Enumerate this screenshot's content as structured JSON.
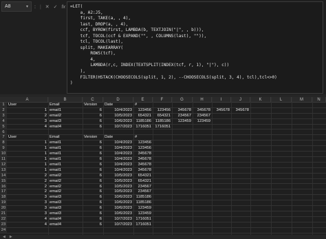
{
  "namebox": {
    "value": "A8"
  },
  "formula_bar": {
    "colon": ":",
    "cancel_icon": "x-icon",
    "enter_icon": "check-icon",
    "fx_label": "fx",
    "chevron": "⌄",
    "formula": "=LET(\n    a, A2:J5,\n    first, TAKE(a, , 4),\n    last, DROP(a, , 4),\n    ccf, BYROW(first, LAMBDA(b, TEXTJOIN(\"|\", , b))),\n    tcf, TOCOL(ccf & EXPAND(\"\", , COLUMNS(last), \"\")),\n    tcl, TOCOL(last),\n    split, MAKEARRAY(\n        ROWS(tcf),\n        4,\n        LAMBDA(r,c, INDEX(TEXTSPLIT(INDEX(tcf, r, 1), \"|\"), c))\n    ),\n    FILTER(HSTACK(CHOOSECOLS(split, 1, 2), --CHOOSECOLS(split, 3, 4), tcl),tcl<>0)\n)"
  },
  "columns": [
    "A",
    "B",
    "C",
    "D",
    "E",
    "F",
    "G",
    "H",
    "I",
    "J",
    "K",
    "L",
    "M",
    "N"
  ],
  "rows": [
    {
      "n": "1",
      "a": "User",
      "b": "Email",
      "c": "Version",
      "d": "Date",
      "e": "#",
      "f": "",
      "g": "",
      "h": "",
      "i": "",
      "j": ""
    },
    {
      "n": "2",
      "a": "1",
      "b": "email1",
      "c": "6",
      "d": "10/4/2023",
      "e": "123456",
      "f": "123456",
      "g": "345678",
      "h": "345678",
      "i": "345678",
      "j": "345678"
    },
    {
      "n": "3",
      "a": "2",
      "b": "email2",
      "c": "6",
      "d": "10/5/2023",
      "e": "654321",
      "f": "654321",
      "g": "234567",
      "h": "234567",
      "i": "",
      "j": ""
    },
    {
      "n": "4",
      "a": "3",
      "b": "email3",
      "c": "6",
      "d": "10/6/2023",
      "e": "1185186",
      "f": "1185186",
      "g": "123459",
      "h": "123459",
      "i": "",
      "j": ""
    },
    {
      "n": "5",
      "a": "4",
      "b": "email4",
      "c": "6",
      "d": "10/7/2023",
      "e": "1716051",
      "f": "1716051",
      "g": "",
      "h": "",
      "i": "",
      "j": ""
    },
    {
      "n": "6",
      "a": "",
      "b": "",
      "c": "",
      "d": "",
      "e": "",
      "f": "",
      "g": "",
      "h": "",
      "i": "",
      "j": ""
    },
    {
      "n": "7",
      "a": "User",
      "b": "Email",
      "c": "Version",
      "d": "Date",
      "e": "#",
      "f": "",
      "g": "",
      "h": "",
      "i": "",
      "j": ""
    },
    {
      "n": "8",
      "a": "1",
      "b": "email1",
      "c": "6",
      "d": "10/4/2023",
      "e": "123456",
      "f": "",
      "g": "",
      "h": "",
      "i": "",
      "j": ""
    },
    {
      "n": "9",
      "a": "1",
      "b": "email1",
      "c": "6",
      "d": "10/4/2023",
      "e": "123456",
      "f": "",
      "g": "",
      "h": "",
      "i": "",
      "j": ""
    },
    {
      "n": "10",
      "a": "1",
      "b": "email1",
      "c": "6",
      "d": "10/4/2023",
      "e": "345678",
      "f": "",
      "g": "",
      "h": "",
      "i": "",
      "j": ""
    },
    {
      "n": "11",
      "a": "1",
      "b": "email1",
      "c": "6",
      "d": "10/4/2023",
      "e": "345678",
      "f": "",
      "g": "",
      "h": "",
      "i": "",
      "j": ""
    },
    {
      "n": "12",
      "a": "1",
      "b": "email1",
      "c": "6",
      "d": "10/4/2023",
      "e": "345678",
      "f": "",
      "g": "",
      "h": "",
      "i": "",
      "j": ""
    },
    {
      "n": "13",
      "a": "1",
      "b": "email1",
      "c": "6",
      "d": "10/4/2023",
      "e": "345678",
      "f": "",
      "g": "",
      "h": "",
      "i": "",
      "j": ""
    },
    {
      "n": "14",
      "a": "2",
      "b": "email2",
      "c": "6",
      "d": "10/5/2023",
      "e": "654321",
      "f": "",
      "g": "",
      "h": "",
      "i": "",
      "j": ""
    },
    {
      "n": "15",
      "a": "2",
      "b": "email2",
      "c": "6",
      "d": "10/5/2023",
      "e": "654321",
      "f": "",
      "g": "",
      "h": "",
      "i": "",
      "j": ""
    },
    {
      "n": "16",
      "a": "2",
      "b": "email2",
      "c": "6",
      "d": "10/5/2023",
      "e": "234567",
      "f": "",
      "g": "",
      "h": "",
      "i": "",
      "j": ""
    },
    {
      "n": "17",
      "a": "2",
      "b": "email2",
      "c": "6",
      "d": "10/5/2023",
      "e": "234567",
      "f": "",
      "g": "",
      "h": "",
      "i": "",
      "j": ""
    },
    {
      "n": "18",
      "a": "3",
      "b": "email3",
      "c": "6",
      "d": "10/6/2023",
      "e": "1185186",
      "f": "",
      "g": "",
      "h": "",
      "i": "",
      "j": ""
    },
    {
      "n": "19",
      "a": "3",
      "b": "email3",
      "c": "6",
      "d": "10/6/2023",
      "e": "1185186",
      "f": "",
      "g": "",
      "h": "",
      "i": "",
      "j": ""
    },
    {
      "n": "20",
      "a": "3",
      "b": "email3",
      "c": "6",
      "d": "10/6/2023",
      "e": "123459",
      "f": "",
      "g": "",
      "h": "",
      "i": "",
      "j": ""
    },
    {
      "n": "21",
      "a": "3",
      "b": "email3",
      "c": "6",
      "d": "10/6/2023",
      "e": "123459",
      "f": "",
      "g": "",
      "h": "",
      "i": "",
      "j": ""
    },
    {
      "n": "22",
      "a": "4",
      "b": "email4",
      "c": "6",
      "d": "10/7/2023",
      "e": "1716051",
      "f": "",
      "g": "",
      "h": "",
      "i": "",
      "j": ""
    },
    {
      "n": "23",
      "a": "4",
      "b": "email4",
      "c": "6",
      "d": "10/7/2023",
      "e": "1716051",
      "f": "",
      "g": "",
      "h": "",
      "i": "",
      "j": ""
    },
    {
      "n": "24",
      "a": "",
      "b": "",
      "c": "",
      "d": "",
      "e": "",
      "f": "",
      "g": "",
      "h": "",
      "i": "",
      "j": ""
    }
  ]
}
